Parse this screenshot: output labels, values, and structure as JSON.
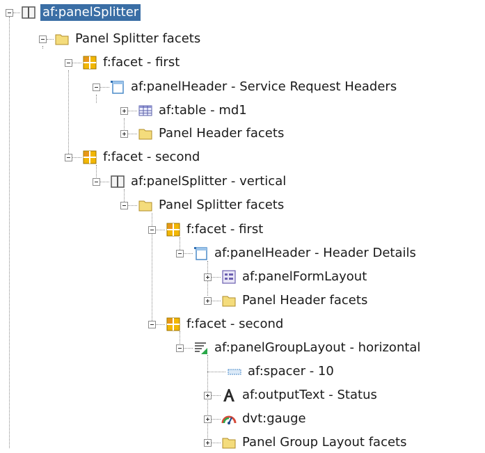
{
  "tree": {
    "root": {
      "label": "af:panelSplitter",
      "icon": "panel-splitter-icon",
      "selected": true
    },
    "nodes": [
      {
        "label": "Panel Splitter facets",
        "icon": "folder-icon",
        "expander": "minus"
      },
      {
        "label": "f:facet - first",
        "icon": "facet-icon",
        "expander": "minus"
      },
      {
        "label": "af:panelHeader - Service Request Headers",
        "icon": "panel-header-icon",
        "expander": "minus"
      },
      {
        "label": "af:table - md1",
        "icon": "table-icon",
        "expander": "plus"
      },
      {
        "label": "Panel Header facets",
        "icon": "folder-icon",
        "expander": "plus"
      },
      {
        "label": "f:facet - second",
        "icon": "facet-icon",
        "expander": "minus"
      },
      {
        "label": "af:panelSplitter - vertical",
        "icon": "panel-splitter-icon",
        "expander": "minus"
      },
      {
        "label": "Panel Splitter facets",
        "icon": "folder-icon",
        "expander": "minus"
      },
      {
        "label": "f:facet - first",
        "icon": "facet-icon",
        "expander": "minus"
      },
      {
        "label": "af:panelHeader - Header Details",
        "icon": "panel-header-icon",
        "expander": "minus"
      },
      {
        "label": "af:panelFormLayout",
        "icon": "form-layout-icon",
        "expander": "plus"
      },
      {
        "label": "Panel Header facets",
        "icon": "folder-icon",
        "expander": "plus"
      },
      {
        "label": "f:facet - second",
        "icon": "facet-icon",
        "expander": "minus"
      },
      {
        "label": "af:panelGroupLayout - horizontal",
        "icon": "group-layout-icon",
        "expander": "minus"
      },
      {
        "label": "af:spacer - 10",
        "icon": "spacer-icon",
        "expander": "none"
      },
      {
        "label": "af:outputText - Status",
        "icon": "output-text-icon",
        "expander": "plus"
      },
      {
        "label": "dvt:gauge",
        "icon": "gauge-icon",
        "expander": "plus"
      },
      {
        "label": "Panel Group Layout facets",
        "icon": "folder-icon",
        "expander": "plus"
      }
    ]
  },
  "colors": {
    "selection": "#3a6ea5",
    "folder": "#f4dc7c",
    "facet": "#f2b705",
    "connector": "#8a8a8a"
  }
}
